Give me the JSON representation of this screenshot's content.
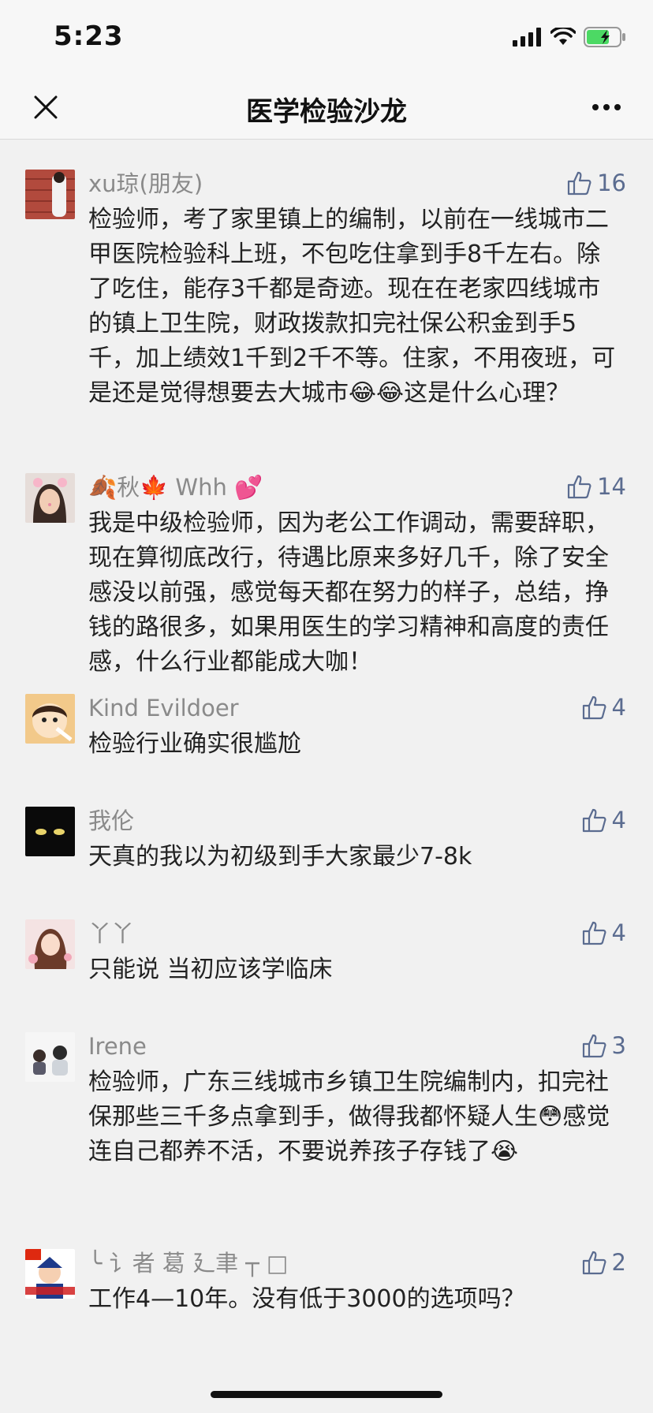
{
  "status": {
    "time": "5:23"
  },
  "nav": {
    "title": "医学检验沙龙"
  },
  "comments": [
    {
      "name": "xu琼(朋友)",
      "likes": "16",
      "text": "检验师，考了家里镇上的编制，以前在一线城市二甲医院检验科上班，不包吃住拿到手8千左右。除了吃住，能存3千都是奇迹。现在在老家四线城市的镇上卫生院，财政拨款扣完社保公积金到手5千，加上绩效1千到2千不等。住家，不用夜班，可是还是觉得想要去大城市😂😂这是什么心理？"
    },
    {
      "name": "🍂秋🍁 Whh 💕",
      "likes": "14",
      "text": "我是中级检验师，因为老公工作调动，需要辞职，现在算彻底改行，待遇比原来多好几千，除了安全感没以前强，感觉每天都在努力的样子，总结，挣钱的路很多，如果用医生的学习精神和高度的责任感，什么行业都能成大咖！"
    },
    {
      "name": "Kind Evildoer",
      "likes": "4",
      "text": "检验行业确实很尴尬"
    },
    {
      "name": "我伦",
      "likes": "4",
      "text": "天真的我以为初级到手大家最少7-8k"
    },
    {
      "name": "丫丫",
      "likes": "4",
      "text": "只能说 当初应该学临床"
    },
    {
      "name": "Irene",
      "likes": "3",
      "text": "检验师，广东三线城市乡镇卫生院编制内，扣完社保那些三千多点拿到手，做得我都怀疑人生😳感觉连自己都养不活，不要说养孩子存钱了😭"
    },
    {
      "name": "╰ 讠者 葛 廴聿 ┬ □",
      "likes": "2",
      "text": "工作4—10年。没有低于3000的选项吗？"
    }
  ]
}
